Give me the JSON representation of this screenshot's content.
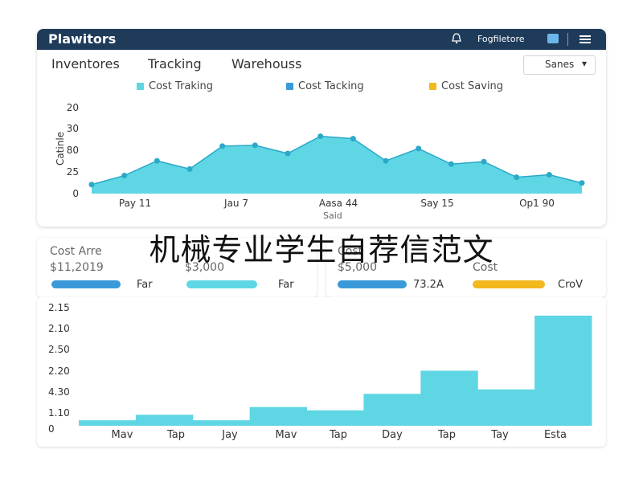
{
  "app": {
    "title": "Plawitors",
    "user_name": "Fogfiletore"
  },
  "tabs": [
    "Inventores",
    "Tracking",
    "Warehouss"
  ],
  "dropdown": {
    "value": "Sanes"
  },
  "area_legend": [
    {
      "label": "Cost Traking",
      "color": "#5fd6e3"
    },
    {
      "label": "Cost Tacking",
      "color": "#3a9ad9"
    },
    {
      "label": "Cost Saving",
      "color": "#f2b81c"
    }
  ],
  "overlay": {
    "title": "机械专业学生自荐信范文"
  },
  "stats": {
    "card1": {
      "title": "Cost Arre",
      "value_a": "$11,2019",
      "value_b": "$3,000",
      "bar_a_label": "Far",
      "bar_b_label": "Far",
      "bar_a_color": "#3a9ad9",
      "bar_b_color": "#5fd6e3"
    },
    "card2": {
      "title": "Cost",
      "value": "$5,000",
      "subtitle": "Cost",
      "bar_a_label": "73.2A",
      "bar_b_label": "CroV",
      "bar_a_color": "#3a9ad9",
      "bar_b_color": "#f2b81c"
    }
  },
  "chart_data": [
    {
      "type": "area",
      "title": "",
      "ylabel": "Catinle",
      "xlabel": "Said",
      "ytick_labels": [
        "20",
        "30",
        "80",
        "25",
        "0"
      ],
      "xtick_labels": [
        "Pay 11",
        "Jau 7",
        "Aasa 44",
        "Say 15",
        "Op1 90"
      ],
      "ylim": [
        0,
        100
      ],
      "x": [
        0,
        1,
        2,
        3,
        4,
        5,
        6,
        7,
        8,
        9,
        10,
        11,
        12,
        13,
        14,
        15,
        16,
        17
      ],
      "values": [
        11,
        22,
        40,
        30,
        58,
        59,
        49,
        70,
        67,
        40,
        55,
        36,
        39,
        20,
        23,
        13
      ],
      "color": "#5fd6e3",
      "marker_color": "#2aa9c9"
    },
    {
      "type": "bar",
      "title": "",
      "ytick_labels": [
        "2.15",
        "2.10",
        "2.50",
        "2.20",
        "4.30",
        "1.10",
        "0"
      ],
      "categories": [
        "Mav",
        "Tap",
        "Jay",
        "Mav",
        "Tap",
        "Day",
        "Tap",
        "Tay",
        "Esta"
      ],
      "values": [
        5,
        10,
        5,
        17,
        14,
        29,
        50,
        33,
        100
      ],
      "ylim": [
        0,
        105
      ],
      "color": "#5fd6e3"
    }
  ]
}
